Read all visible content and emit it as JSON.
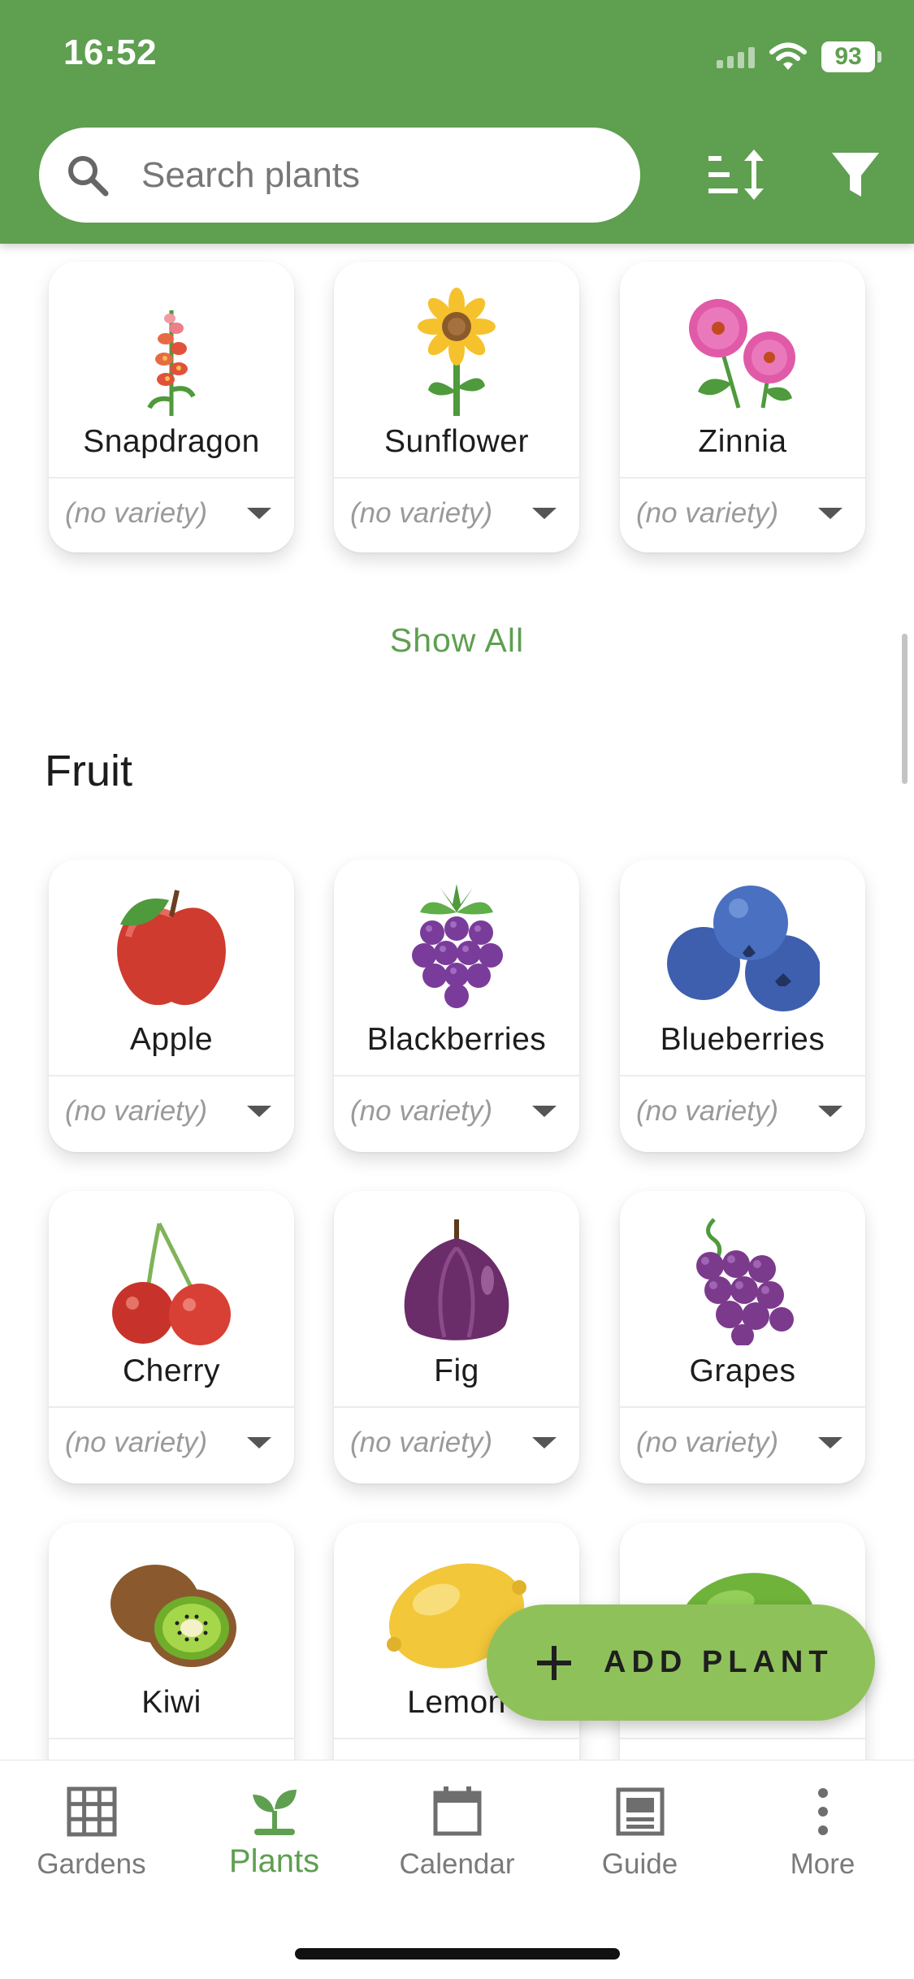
{
  "status_bar": {
    "time": "16:52",
    "battery": "93"
  },
  "header": {
    "search_placeholder": "Search plants"
  },
  "sections": {
    "flowers_partial": {
      "cards": [
        {
          "name": "Snapdragon",
          "variety": "(no variety)"
        },
        {
          "name": "Sunflower",
          "variety": "(no variety)"
        },
        {
          "name": "Zinnia",
          "variety": "(no variety)"
        }
      ],
      "show_all": "Show All"
    },
    "fruit": {
      "title": "Fruit",
      "cards": [
        {
          "name": "Apple",
          "variety": "(no variety)"
        },
        {
          "name": "Blackberries",
          "variety": "(no variety)"
        },
        {
          "name": "Blueberries",
          "variety": "(no variety)"
        },
        {
          "name": "Cherry",
          "variety": "(no variety)"
        },
        {
          "name": "Fig",
          "variety": "(no variety)"
        },
        {
          "name": "Grapes",
          "variety": "(no variety)"
        },
        {
          "name": "Kiwi"
        },
        {
          "name": "Lemon"
        },
        {
          "name": ""
        }
      ]
    }
  },
  "fab": {
    "label": "ADD PLANT"
  },
  "bottom_nav": {
    "items": [
      {
        "label": "Gardens",
        "icon": "grid-icon"
      },
      {
        "label": "Plants",
        "icon": "sprout-icon",
        "active": true
      },
      {
        "label": "Calendar",
        "icon": "calendar-icon"
      },
      {
        "label": "Guide",
        "icon": "guide-icon"
      },
      {
        "label": "More",
        "icon": "more-vertical-icon"
      }
    ]
  },
  "colors": {
    "primary": "#5e9f50",
    "fab": "#8fc15a",
    "text": "#1c1c1c",
    "muted": "#9a9a9a"
  }
}
